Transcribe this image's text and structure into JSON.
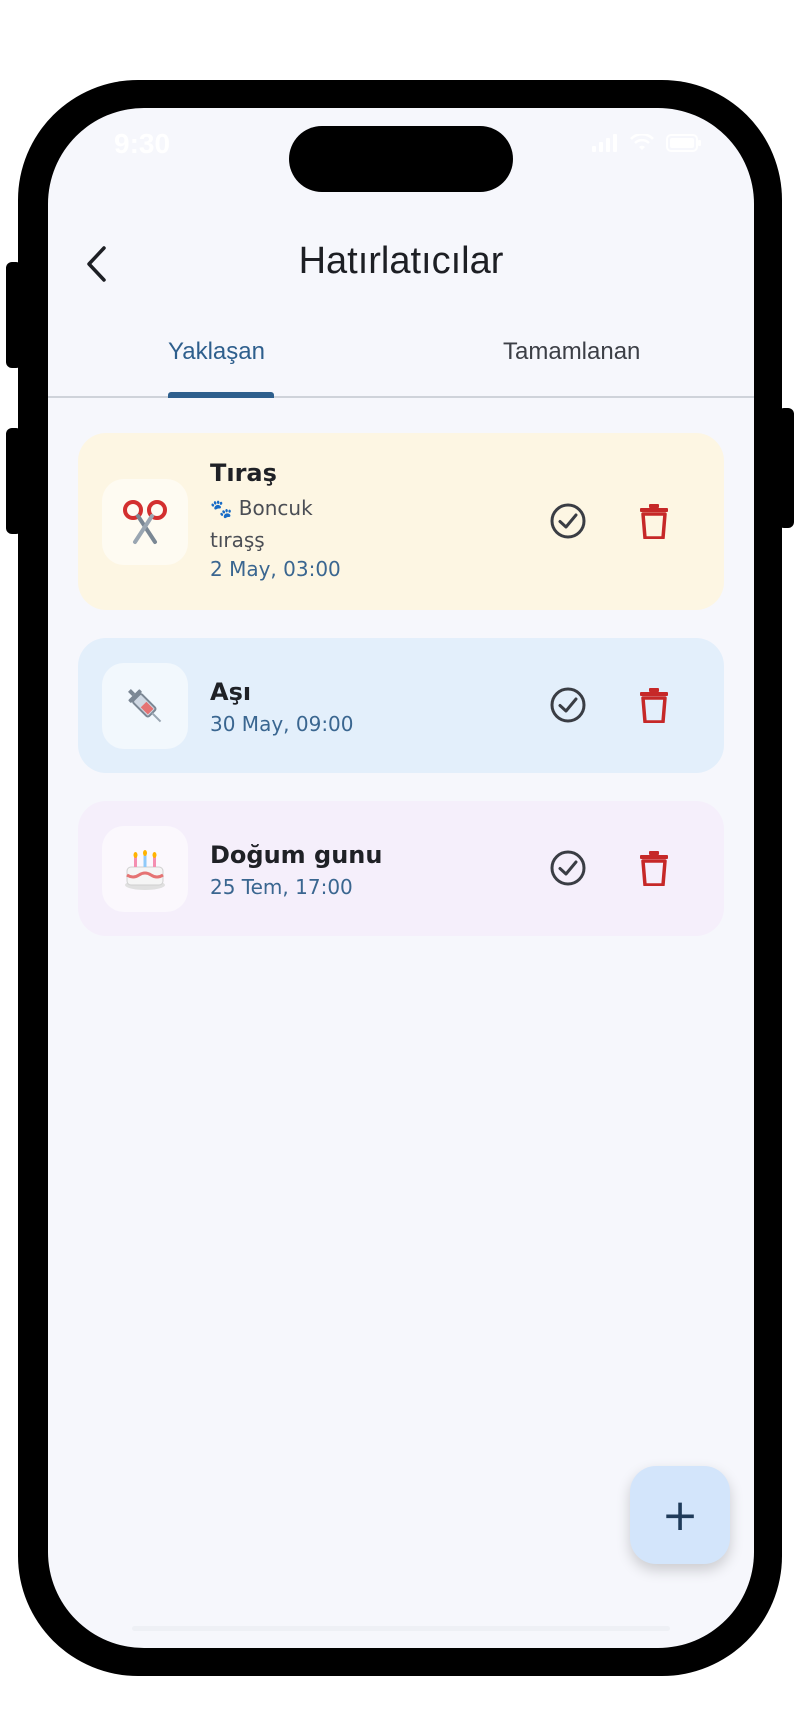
{
  "status_bar": {
    "time": "9:30"
  },
  "header": {
    "title": "Hatırlatıcılar",
    "back_icon": "chevron-left-icon"
  },
  "tabs": [
    {
      "label": "Yaklaşan",
      "active": true
    },
    {
      "label": "Tamamlanan",
      "active": false
    }
  ],
  "reminders": [
    {
      "title": "Tıraş",
      "icon": "scissors-icon",
      "emoji": "✂️",
      "pet_icon": "🐾",
      "pet_name": "Boncuk",
      "note": "tıraşş",
      "datetime": "2 May, 03:00",
      "background": "#fdf6e3"
    },
    {
      "title": "Aşı",
      "icon": "syringe-icon",
      "emoji": "💉",
      "datetime": "30 May, 09:00",
      "background": "#e3effb"
    },
    {
      "title": "Doğum gunu",
      "icon": "cake-icon",
      "emoji": "🎂",
      "datetime": "25 Tem, 17:00",
      "background": "#f5effb"
    }
  ],
  "actions": {
    "complete_icon": "check-circle-icon",
    "delete_icon": "trash-icon"
  },
  "fab": {
    "label": "+"
  },
  "colors": {
    "accent": "#2e5f8d",
    "delete": "#c62828",
    "screen_bg": "#f6f7fc",
    "fab_bg": "#d3e5fb"
  }
}
